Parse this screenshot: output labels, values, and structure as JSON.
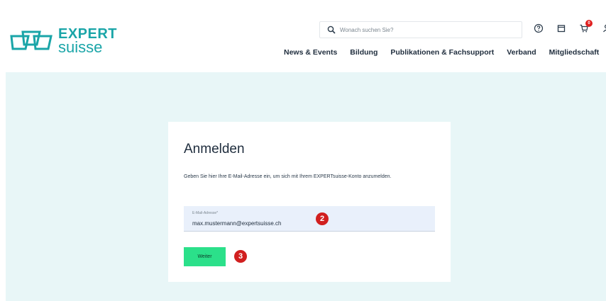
{
  "brand": {
    "name_top": "EXPERT",
    "name_bottom": "suisse",
    "color": "#1aa5a8"
  },
  "search": {
    "placeholder": "Wonach suchen Sie?"
  },
  "header_icons": [
    {
      "name": "help-icon"
    },
    {
      "name": "calendar-icon"
    },
    {
      "name": "cart-icon",
      "badge": "0"
    },
    {
      "name": "user-icon"
    }
  ],
  "nav": {
    "items": [
      {
        "label": "News & Events"
      },
      {
        "label": "Bildung"
      },
      {
        "label": "Publikationen & Fachsupport"
      },
      {
        "label": "Verband"
      },
      {
        "label": "Mitgliedschaft"
      }
    ]
  },
  "login": {
    "title": "Anmelden",
    "description": "Geben Sie hier Ihre E-Mail-Adresse ein, um sich mit Ihrem EXPERTsuisse-Konto anzumelden.",
    "email_label": "E-Mail-Adresse*",
    "email_value": "max.mustermann@expertsuisse.ch",
    "submit_label": "Weiter"
  },
  "annotations": {
    "marker_2": "2",
    "marker_3": "3"
  },
  "colors": {
    "background_band": "#e8f6f7",
    "button": "#2be08a",
    "marker": "#d11f1f",
    "input_bg": "#e9f0fb"
  }
}
